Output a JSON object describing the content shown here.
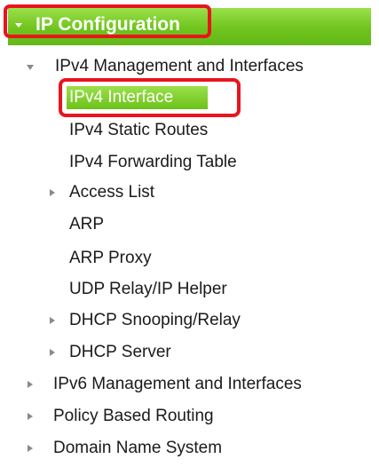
{
  "section": {
    "title": "IP Configuration",
    "accent_color": "#6fc41d",
    "highlight_color": "#e8141e",
    "arrow_icon": "chevron-down-icon"
  },
  "menu": {
    "ipv4_management": {
      "label": "IPv4 Management and Interfaces",
      "icon": "triangle-down-icon",
      "children": {
        "ipv4_interface": "IPv4 Interface",
        "ipv4_static_routes": "IPv4 Static Routes",
        "ipv4_forwarding_table": "IPv4 Forwarding Table",
        "access_list": "Access List",
        "arp": "ARP",
        "arp_proxy": "ARP Proxy",
        "udp_relay": "UDP Relay/IP Helper",
        "dhcp_snooping": "DHCP Snooping/Relay",
        "dhcp_server": "DHCP Server"
      }
    },
    "ipv6_management": "IPv6 Management and Interfaces",
    "policy_based_routing": "Policy Based Routing",
    "domain_name_system": "Domain Name System",
    "collapsed_icon": "triangle-right-icon",
    "selected_item": "IPv4 Interface"
  }
}
